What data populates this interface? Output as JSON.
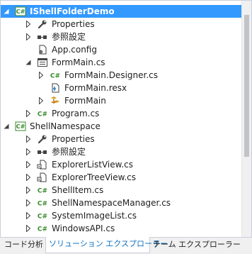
{
  "tree": {
    "items": [
      {
        "label": "IShellFolderDemo",
        "icon": "csharp-project-icon",
        "level": 0,
        "expander": "expanded",
        "selected": true
      },
      {
        "label": "Properties",
        "icon": "wrench-icon",
        "level": 1,
        "expander": "collapsed"
      },
      {
        "label": "参照設定",
        "icon": "references-icon",
        "level": 1,
        "expander": "collapsed"
      },
      {
        "label": "App.config",
        "icon": "config-file-icon",
        "level": 1,
        "expander": "none"
      },
      {
        "label": "FormMain.cs",
        "icon": "form-icon",
        "level": 1,
        "expander": "expanded"
      },
      {
        "label": "FormMain.Designer.cs",
        "icon": "csharp-file-icon",
        "level": 2,
        "expander": "collapsed"
      },
      {
        "label": "FormMain.resx",
        "icon": "resource-file-icon",
        "level": 2,
        "expander": "none"
      },
      {
        "label": "FormMain",
        "icon": "class-icon",
        "level": 2,
        "expander": "collapsed"
      },
      {
        "label": "Program.cs",
        "icon": "csharp-file-icon",
        "level": 1,
        "expander": "collapsed"
      },
      {
        "label": "ShellNamespace",
        "icon": "csharp-project-icon",
        "level": 0,
        "expander": "expanded"
      },
      {
        "label": "Properties",
        "icon": "wrench-icon",
        "level": 1,
        "expander": "collapsed"
      },
      {
        "label": "参照設定",
        "icon": "references-icon",
        "level": 1,
        "expander": "collapsed"
      },
      {
        "label": "ExplorerListView.cs",
        "icon": "component-file-icon",
        "level": 1,
        "expander": "collapsed"
      },
      {
        "label": "ExplorerTreeView.cs",
        "icon": "component-file-icon",
        "level": 1,
        "expander": "collapsed"
      },
      {
        "label": "ShellItem.cs",
        "icon": "csharp-file-icon",
        "level": 1,
        "expander": "collapsed"
      },
      {
        "label": "ShellNamespaceManager.cs",
        "icon": "csharp-file-icon",
        "level": 1,
        "expander": "collapsed"
      },
      {
        "label": "SystemImageList.cs",
        "icon": "csharp-file-icon",
        "level": 1,
        "expander": "collapsed"
      },
      {
        "label": "WindowsAPI.cs",
        "icon": "csharp-file-icon",
        "level": 1,
        "expander": "collapsed"
      }
    ]
  },
  "tabs": [
    {
      "label": "コード分析",
      "active": false
    },
    {
      "label": "ソリューション エクスプローラー",
      "active": true
    },
    {
      "label": "チーム エクスプローラー",
      "active": false
    }
  ],
  "colors": {
    "selection": "#3399ff",
    "active_tab_text": "#0e70c0",
    "csharp_green": "#3a8a2e"
  }
}
